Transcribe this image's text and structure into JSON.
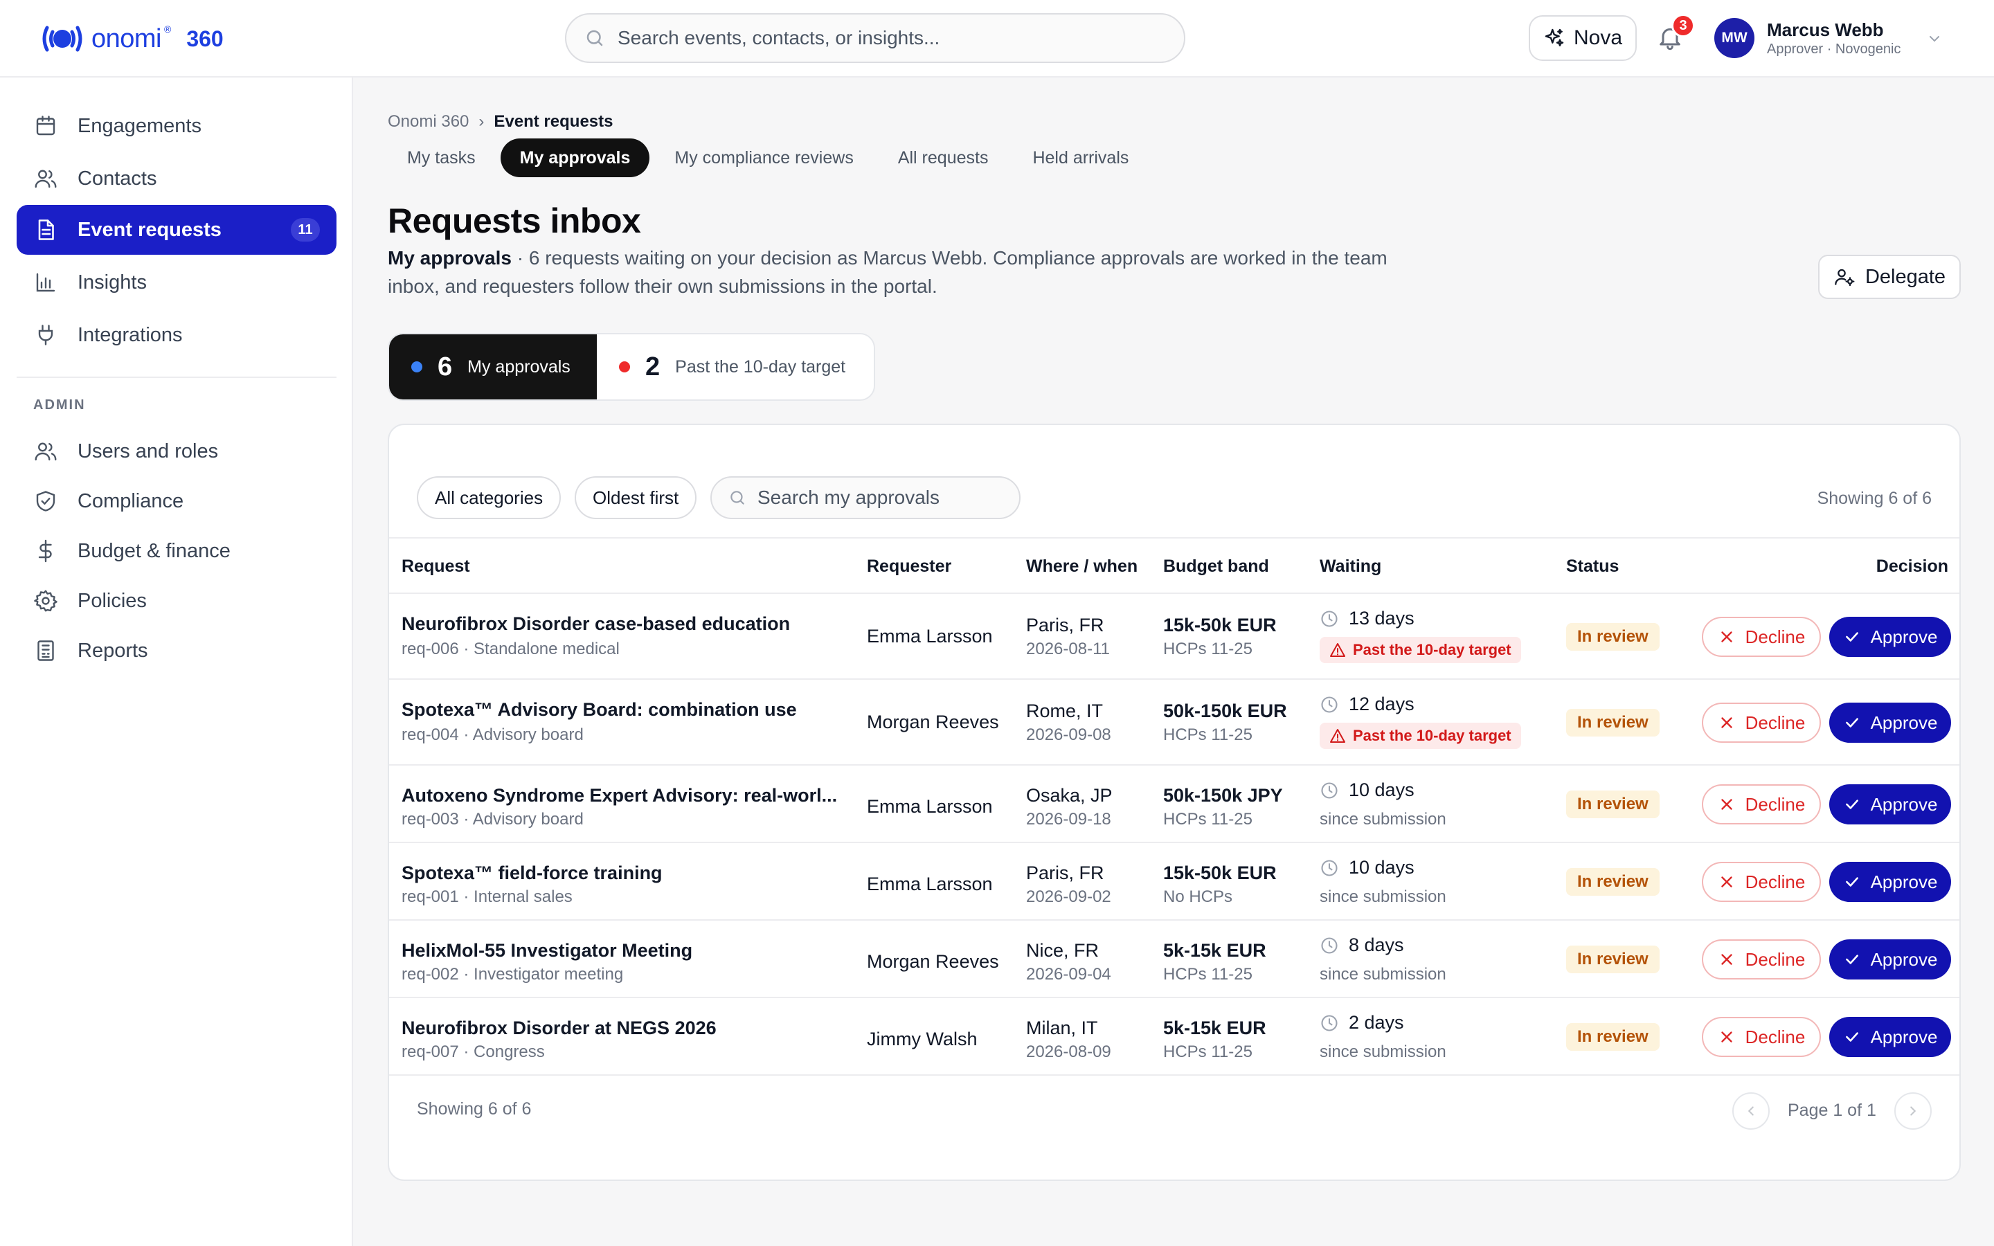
{
  "app": {
    "brand": "onomi",
    "brand_mark": "®",
    "product_number": "360"
  },
  "header": {
    "search_placeholder": "Search events, contacts, or insights...",
    "nova_label": "Nova",
    "notification_count": "3",
    "user": {
      "initials": "MW",
      "name": "Marcus Webb",
      "role": "Approver · Novogenic"
    }
  },
  "sidebar": {
    "items": [
      {
        "label": "Engagements",
        "icon": "calendar-icon"
      },
      {
        "label": "Contacts",
        "icon": "users-icon"
      },
      {
        "label": "Event requests",
        "icon": "document-icon",
        "count": "11",
        "active": true
      },
      {
        "label": "Insights",
        "icon": "bar-chart-icon"
      },
      {
        "label": "Integrations",
        "icon": "plug-icon"
      }
    ],
    "admin_label": "ADMIN",
    "admin_items": [
      {
        "label": "Users and roles",
        "icon": "users-icon"
      },
      {
        "label": "Compliance",
        "icon": "shield-check-icon"
      },
      {
        "label": "Budget & finance",
        "icon": "dollar-icon"
      },
      {
        "label": "Policies",
        "icon": "gear-icon"
      },
      {
        "label": "Reports",
        "icon": "reports-icon"
      }
    ]
  },
  "breadcrumb": {
    "root": "Onomi 360",
    "separator": "›",
    "current": "Event requests"
  },
  "tabs": [
    {
      "label": "My tasks",
      "active": false
    },
    {
      "label": "My approvals",
      "active": true
    },
    {
      "label": "My compliance reviews",
      "active": false
    },
    {
      "label": "All requests",
      "active": false
    },
    {
      "label": "Held arrivals",
      "active": false
    }
  ],
  "page": {
    "title": "Requests inbox",
    "subtitle_lead": "My approvals",
    "subtitle_rest": " · 6 requests waiting on your decision as Marcus Webb. Compliance approvals are worked in the team inbox, and requesters follow their own submissions in the portal.",
    "delegate_label": "Delegate"
  },
  "summary": [
    {
      "count": "6",
      "label": "My approvals",
      "dot_color": "#3b82f6"
    },
    {
      "count": "2",
      "label": "Past the 10-day target",
      "dot_color": "#ef2b2b"
    }
  ],
  "filters": {
    "category_label": "All categories",
    "sort_label": "Oldest first",
    "search_placeholder": "Search my approvals",
    "showing": "Showing 6 of 6"
  },
  "table": {
    "columns": [
      "Request",
      "Requester",
      "Where / when",
      "Budget band",
      "Waiting",
      "Status",
      "Decision"
    ],
    "decline_label": "Decline",
    "approve_label": "Approve",
    "rows": [
      {
        "title": "Neurofibrox Disorder case-based education",
        "meta": "req-006 · Standalone medical",
        "requester": "Emma Larsson",
        "where": "Paris, FR",
        "when": "2026-08-11",
        "budget": "15k-50k EUR",
        "hcps": "HCPs 11-25",
        "waiting": "13 days",
        "late": "Past the 10-day target",
        "since": "",
        "status": "In review"
      },
      {
        "title": "Spotexa™ Advisory Board: combination use",
        "meta": "req-004 · Advisory board",
        "requester": "Morgan Reeves",
        "where": "Rome, IT",
        "when": "2026-09-08",
        "budget": "50k-150k EUR",
        "hcps": "HCPs 11-25",
        "waiting": "12 days",
        "late": "Past the 10-day target",
        "since": "",
        "status": "In review"
      },
      {
        "title": "Autoxeno Syndrome Expert Advisory: real-worl...",
        "meta": "req-003 · Advisory board",
        "requester": "Emma Larsson",
        "where": "Osaka, JP",
        "when": "2026-09-18",
        "budget": "50k-150k JPY",
        "hcps": "HCPs 11-25",
        "waiting": "10 days",
        "late": "",
        "since": "since submission",
        "status": "In review"
      },
      {
        "title": "Spotexa™ field-force training",
        "meta": "req-001 · Internal sales",
        "requester": "Emma Larsson",
        "where": "Paris, FR",
        "when": "2026-09-02",
        "budget": "15k-50k EUR",
        "hcps": "No HCPs",
        "waiting": "10 days",
        "late": "",
        "since": "since submission",
        "status": "In review"
      },
      {
        "title": "HelixMol-55 Investigator Meeting",
        "meta": "req-002 · Investigator meeting",
        "requester": "Morgan Reeves",
        "where": "Nice, FR",
        "when": "2026-09-04",
        "budget": "5k-15k EUR",
        "hcps": "HCPs 11-25",
        "waiting": "8 days",
        "late": "",
        "since": "since submission",
        "status": "In review"
      },
      {
        "title": "Neurofibrox Disorder at NEGS 2026",
        "meta": "req-007 · Congress",
        "requester": "Jimmy Walsh",
        "where": "Milan, IT",
        "when": "2026-08-09",
        "budget": "5k-15k EUR",
        "hcps": "HCPs 11-25",
        "waiting": "2 days",
        "late": "",
        "since": "since submission",
        "status": "In review"
      }
    ]
  },
  "pagination": {
    "showing": "Showing 6 of 6",
    "page_label": "Page 1 of 1"
  }
}
